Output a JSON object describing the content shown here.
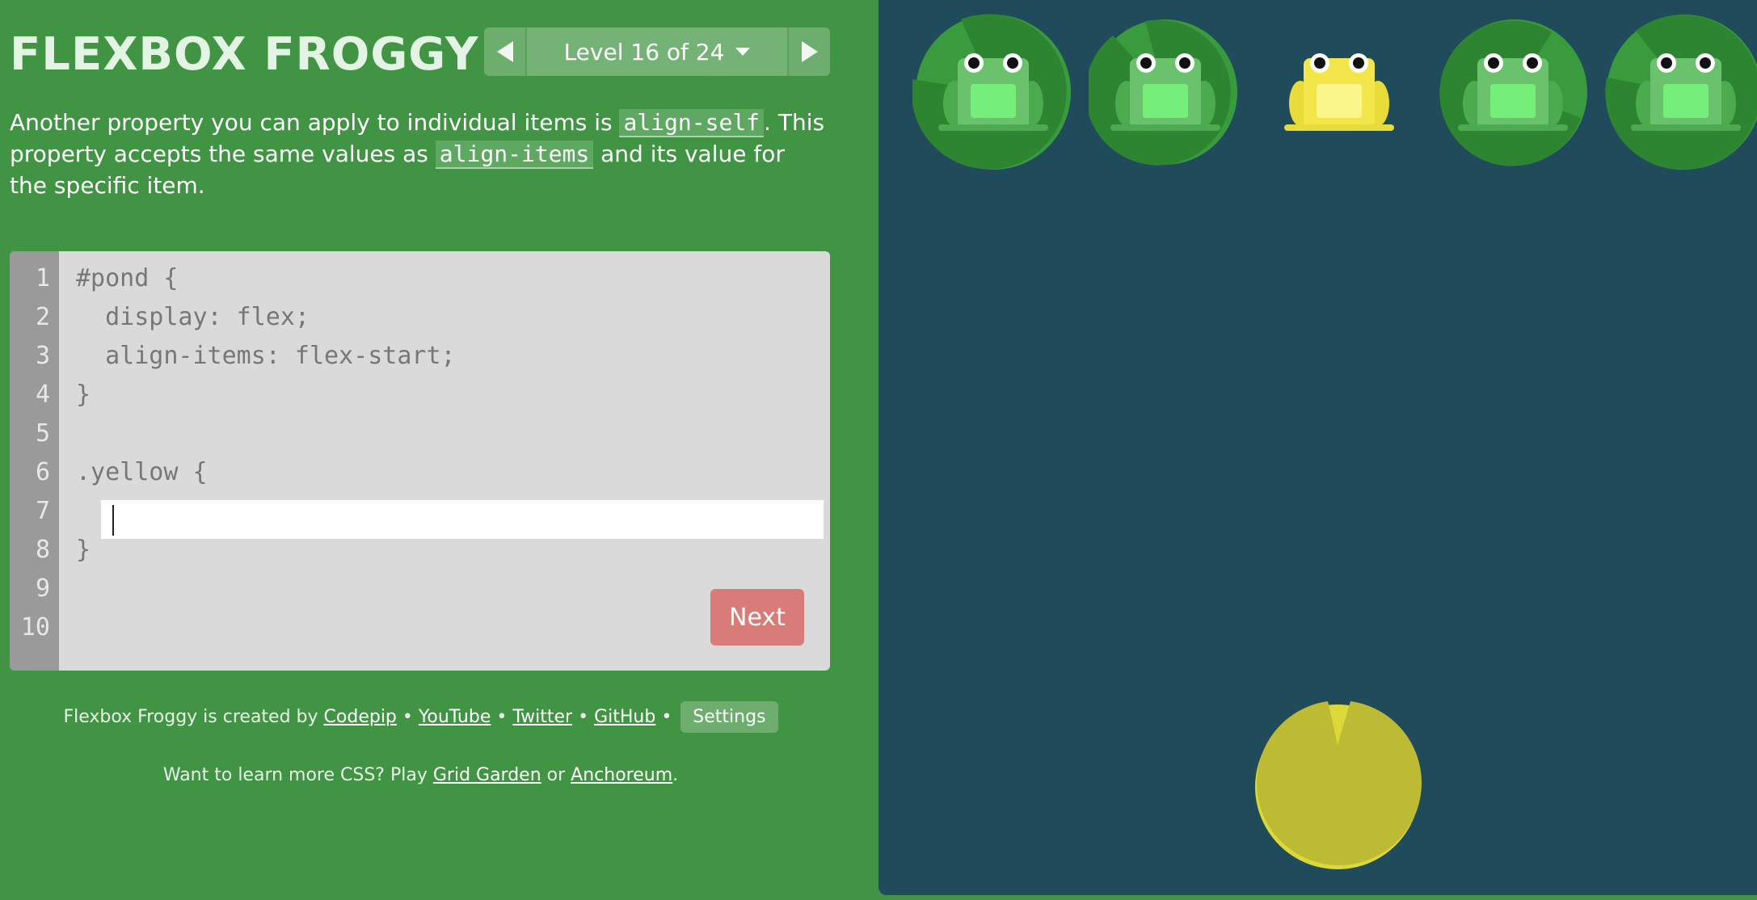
{
  "header": {
    "title": "FLEXBOX FROGGY",
    "level_label": "Level 16 of 24"
  },
  "instructions": {
    "text_1": "Another property you can apply to individual items is ",
    "code_1": "align-self",
    "text_2": ". This property accepts the same values as ",
    "code_2": "align-items",
    "text_3": " and its value for the specific item."
  },
  "editor": {
    "line_numbers": [
      "1",
      "2",
      "3",
      "4",
      "5",
      "6",
      "7",
      "8",
      "9",
      "10"
    ],
    "lines": {
      "l1": "#pond {",
      "l2": "  display: flex;",
      "l3": "  align-items: flex-start;",
      "l4": "}",
      "l6": ".yellow {",
      "l8": "}"
    },
    "input_value": "",
    "next_label": "Next"
  },
  "footer": {
    "credit_prefix": "Flexbox Froggy is created by",
    "codepip": "Codepip",
    "youtube": "YouTube",
    "twitter": "Twitter",
    "github": "GitHub",
    "bullet": "•",
    "settings": "Settings",
    "more_prefix": "Want to learn more CSS? Play",
    "grid_garden": "Grid Garden",
    "or": "or",
    "anchoreum": "Anchoreum",
    "period": "."
  },
  "pond": {
    "frogs": [
      "green",
      "green",
      "yellow",
      "green",
      "green"
    ],
    "lilypads": [
      "green",
      "green",
      "yellow",
      "green",
      "green"
    ]
  },
  "colors": {
    "sidebar_bg": "#409443",
    "pond_bg": "#1f4b5a",
    "green_frog": "#6ac26c",
    "yellow_frog": "#f2e64a",
    "green_pad": "#2d8431",
    "yellow_pad": "#bdbb33",
    "next_button": "#d87c7a"
  }
}
